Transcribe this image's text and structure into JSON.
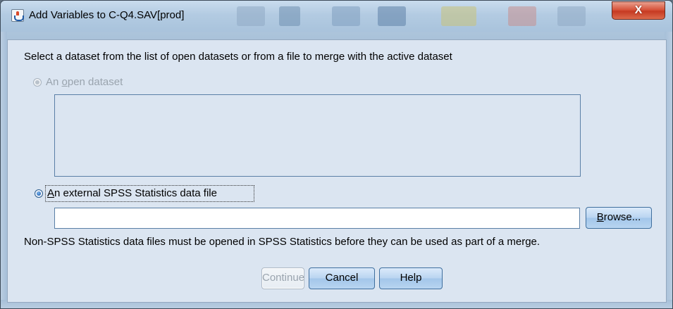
{
  "window": {
    "title": "Add Variables to C-Q4.SAV[prod]",
    "close_glyph": "X",
    "icon": "java-app-icon"
  },
  "dialog": {
    "instruction": "Select a dataset from the list of open datasets or from a file to merge with the active dataset",
    "open_dataset": {
      "label_pre": "An ",
      "label_mnemonic": "o",
      "label_post": "pen dataset",
      "enabled": false,
      "selected": false
    },
    "open_dataset_list": [],
    "external_file": {
      "label_mnemonic": "A",
      "label_post": "n external SPSS Statistics data file",
      "enabled": true,
      "selected": true
    },
    "file_path": {
      "value": ""
    },
    "browse_button": {
      "mnemonic": "B",
      "label_post": "rowse..."
    },
    "note": "Non-SPSS Statistics data files must be opened in SPSS Statistics before they can be used as part of a merge."
  },
  "buttons": {
    "continue": "Continue",
    "cancel": "Cancel",
    "help": "Help"
  },
  "colors": {
    "dialog_background": "#dbe5f1",
    "window_frame": "#a8c1d9",
    "close_button": "#c63a22",
    "button_gradient": "#bad5f1",
    "disabled_text": "#9aa4ae"
  }
}
